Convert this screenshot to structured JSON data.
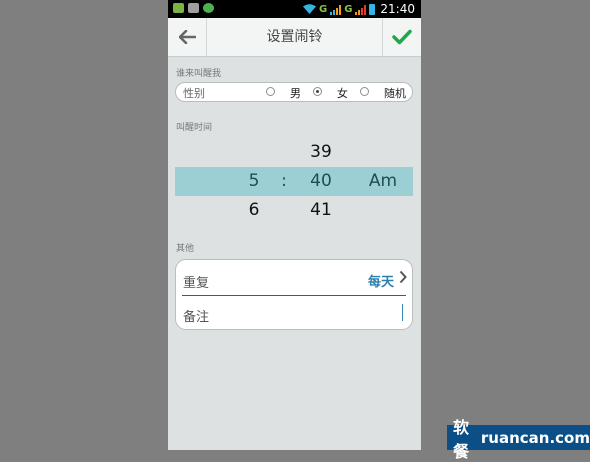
{
  "status_bar": {
    "time": "21:40",
    "network_1": "G",
    "network_2": "G"
  },
  "header": {
    "title": "设置闹铃"
  },
  "caller_section": {
    "label": "谁来叫醒我",
    "field_label": "性别",
    "options": [
      "男",
      "女",
      "随机"
    ],
    "selected": "女"
  },
  "time_section": {
    "label": "叫醒时间",
    "rows": [
      {
        "hour": "",
        "separator": "",
        "minute": "39",
        "ampm": ""
      },
      {
        "hour": "5",
        "separator": ":",
        "minute": "40",
        "ampm": "Am"
      },
      {
        "hour": "6",
        "separator": "",
        "minute": "41",
        "ampm": ""
      }
    ]
  },
  "other_section": {
    "label": "其他",
    "repeat_label": "重复",
    "repeat_value": "每天",
    "note_label": "备注",
    "note_value": ""
  },
  "watermark": {
    "cn": "软餐",
    "domain": "ruancan.com"
  }
}
